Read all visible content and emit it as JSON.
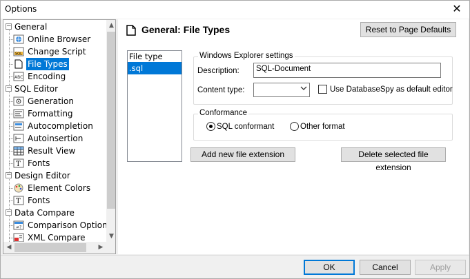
{
  "window": {
    "title": "Options",
    "close_glyph": "✕"
  },
  "tree": {
    "items": [
      {
        "label": "General",
        "level": 0,
        "icon": "none",
        "expander": "−"
      },
      {
        "label": "Online Browser",
        "level": 1,
        "icon": "globe-icon"
      },
      {
        "label": "Change Script",
        "level": 1,
        "icon": "sql-script-icon"
      },
      {
        "label": "File Types",
        "level": 1,
        "icon": "document-icon",
        "selected": true
      },
      {
        "label": "Encoding",
        "level": 1,
        "icon": "encoding-icon"
      },
      {
        "label": "SQL Editor",
        "level": 0,
        "icon": "none",
        "expander": "−"
      },
      {
        "label": "Generation",
        "level": 1,
        "icon": "generation-icon"
      },
      {
        "label": "Formatting",
        "level": 1,
        "icon": "formatting-icon"
      },
      {
        "label": "Autocompletion",
        "level": 1,
        "icon": "autocompletion-icon"
      },
      {
        "label": "Autoinsertion",
        "level": 1,
        "icon": "autoinsertion-icon"
      },
      {
        "label": "Result View",
        "level": 1,
        "icon": "grid-icon"
      },
      {
        "label": "Fonts",
        "level": 1,
        "icon": "font-icon"
      },
      {
        "label": "Design Editor",
        "level": 0,
        "icon": "none",
        "expander": "−"
      },
      {
        "label": "Element Colors",
        "level": 1,
        "icon": "palette-icon"
      },
      {
        "label": "Fonts",
        "level": 1,
        "icon": "font-icon"
      },
      {
        "label": "Data Compare",
        "level": 0,
        "icon": "none",
        "expander": "−"
      },
      {
        "label": "Comparison Options",
        "level": 1,
        "icon": "compare-icon"
      },
      {
        "label": "XML Compare",
        "level": 1,
        "icon": "xml-compare-icon"
      }
    ]
  },
  "page": {
    "title": "General: File Types",
    "reset_button": "Reset to Page Defaults"
  },
  "file_type_list": {
    "header": "File type",
    "rows": [
      ".sql"
    ]
  },
  "explorer_settings": {
    "legend": "Windows Explorer settings",
    "description_label": "Description:",
    "description_value": "SQL-Document",
    "content_type_label": "Content type:",
    "content_type_value": "",
    "default_editor_label": "Use DatabaseSpy as default editor",
    "default_editor_checked": false
  },
  "conformance": {
    "legend": "Conformance",
    "option_sql": "SQL conformant",
    "option_other": "Other format",
    "selected": "SQL conformant"
  },
  "actions": {
    "add_extension": "Add new file extension",
    "delete_extension": "Delete selected file extension"
  },
  "footer": {
    "ok": "OK",
    "cancel": "Cancel",
    "apply": "Apply"
  },
  "colors": {
    "selection": "#0078d7",
    "button_face": "#e1e1e1"
  }
}
